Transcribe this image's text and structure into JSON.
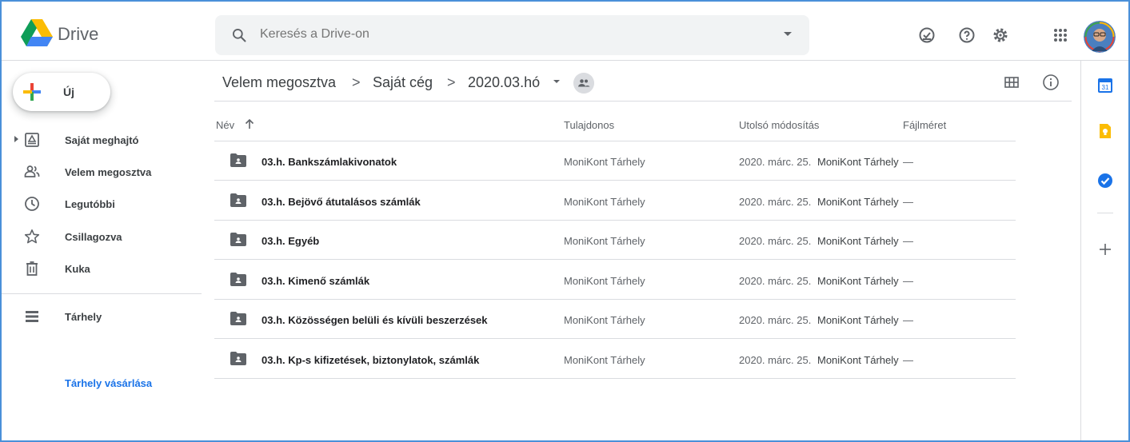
{
  "app": {
    "name": "Drive"
  },
  "search": {
    "placeholder": "Keresés a Drive-on"
  },
  "header_icons": [
    "offline-check-icon",
    "help-icon",
    "settings-icon",
    "apps-icon"
  ],
  "new_button": {
    "label": "Új"
  },
  "sidebar": {
    "items": [
      {
        "label": "Saját meghajtó",
        "icon": "my-drive-icon"
      },
      {
        "label": "Velem megosztva",
        "icon": "shared-with-me-icon"
      },
      {
        "label": "Legutóbbi",
        "icon": "recent-icon"
      },
      {
        "label": "Csillagozva",
        "icon": "star-icon"
      },
      {
        "label": "Kuka",
        "icon": "trash-icon"
      }
    ],
    "storage": {
      "label": "Tárhely",
      "icon": "storage-icon"
    },
    "buy_storage": "Tárhely vásárlása"
  },
  "breadcrumb": {
    "items": [
      "Velem megosztva",
      "Saját cég",
      "2020.03.hó"
    ],
    "separator": ">"
  },
  "table": {
    "columns": {
      "name": "Név",
      "owner": "Tulajdonos",
      "modified": "Utolsó módosítás",
      "size": "Fájlméret"
    },
    "rows": [
      {
        "name": "03.h. Bankszámlakivonatok",
        "owner": "MoniKont Tárhely",
        "date": "2020. márc. 25.",
        "modified_by": "MoniKont Tárhely",
        "size": "—"
      },
      {
        "name": "03.h. Bejövő átutalásos számlák",
        "owner": "MoniKont Tárhely",
        "date": "2020. márc. 25.",
        "modified_by": "MoniKont Tárhely",
        "size": "—"
      },
      {
        "name": "03.h. Egyéb",
        "owner": "MoniKont Tárhely",
        "date": "2020. márc. 25.",
        "modified_by": "MoniKont Tárhely",
        "size": "—"
      },
      {
        "name": "03.h. Kimenő számlák",
        "owner": "MoniKont Tárhely",
        "date": "2020. márc. 25.",
        "modified_by": "MoniKont Tárhely",
        "size": "—"
      },
      {
        "name": "03.h. Közösségen belüli és kívüli beszerzések",
        "owner": "MoniKont Tárhely",
        "date": "2020. márc. 25.",
        "modified_by": "MoniKont Tárhely",
        "size": "—"
      },
      {
        "name": "03.h. Kp-s kifizetések, biztonylatok, számlák",
        "owner": "MoniKont Tárhely",
        "date": "2020. márc. 25.",
        "modified_by": "MoniKont Tárhely",
        "size": "—"
      }
    ]
  },
  "right_panel": {
    "calendar_date": "31",
    "icons": [
      "calendar-icon",
      "keep-icon",
      "tasks-icon",
      "add-addon-icon"
    ]
  },
  "colors": {
    "accent": "#1a73e8",
    "border": "#dadce0",
    "text_muted": "#5f6368"
  }
}
